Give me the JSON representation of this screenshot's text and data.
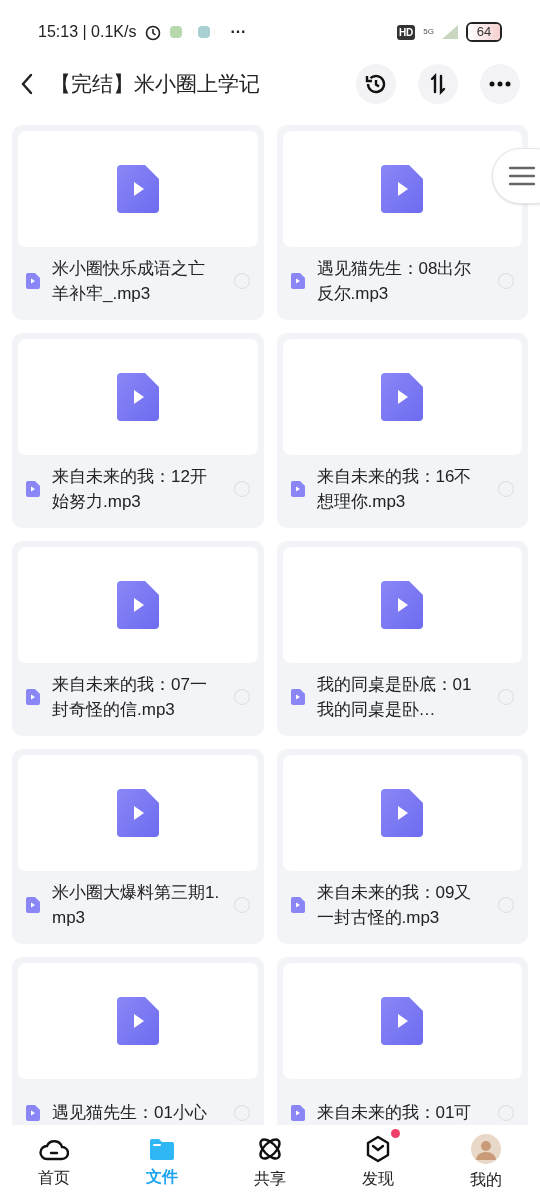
{
  "status_bar": {
    "time": "15:13 | 0.1K/s",
    "more": "···",
    "hd": "HD",
    "network": "5G",
    "battery": "64"
  },
  "header": {
    "title": "【完结】米小圈上学记"
  },
  "files": [
    {
      "name": "米小圈快乐成语之亡羊补牢_.mp3",
      "selected": false
    },
    {
      "name": "遇见猫先生：08出尔反尔.mp3",
      "selected": false
    },
    {
      "name": "来自未来的我：12开始努力.mp3",
      "selected": false
    },
    {
      "name": "来自未来的我：16不想理你.mp3",
      "selected": false
    },
    {
      "name": "来自未来的我：07一封奇怪的信.mp3",
      "selected": false
    },
    {
      "name": "我的同桌是卧底：01我的同桌是卧…",
      "selected": false
    },
    {
      "name": "米小圈大爆料第三期1.mp3",
      "selected": false
    },
    {
      "name": "来自未来的我：09又一封古怪的.mp3",
      "selected": false
    },
    {
      "name": "遇见猫先生：01小心",
      "selected": false
    },
    {
      "name": "来自未来的我：01可",
      "selected": false
    }
  ],
  "nav": [
    {
      "kind": "cloud",
      "label": "首页",
      "selected": false,
      "badge": false
    },
    {
      "kind": "folder",
      "label": "文件",
      "selected": true,
      "badge": false
    },
    {
      "kind": "atom",
      "label": "共享",
      "selected": false,
      "badge": false
    },
    {
      "kind": "cube",
      "label": "发现",
      "selected": false,
      "badge": true
    },
    {
      "kind": "avatar",
      "label": "我的",
      "selected": false,
      "badge": false
    }
  ]
}
